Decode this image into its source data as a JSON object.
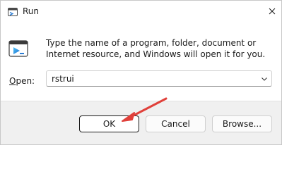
{
  "window": {
    "title": "Run",
    "close_icon": "close-icon",
    "app_icon": "run-app-icon"
  },
  "content": {
    "description": "Type the name of a program, folder, document or Internet resource, and Windows will open it for you.",
    "run_icon": "run-icon"
  },
  "open_field": {
    "label_access_key": "O",
    "label_rest": "pen:",
    "value": "rstrui",
    "dropdown_icon": "chevron-down-icon"
  },
  "buttons": {
    "ok": "OK",
    "cancel": "Cancel",
    "browse": "Browse..."
  },
  "annotation": {
    "arrow_color": "#e0403a"
  }
}
